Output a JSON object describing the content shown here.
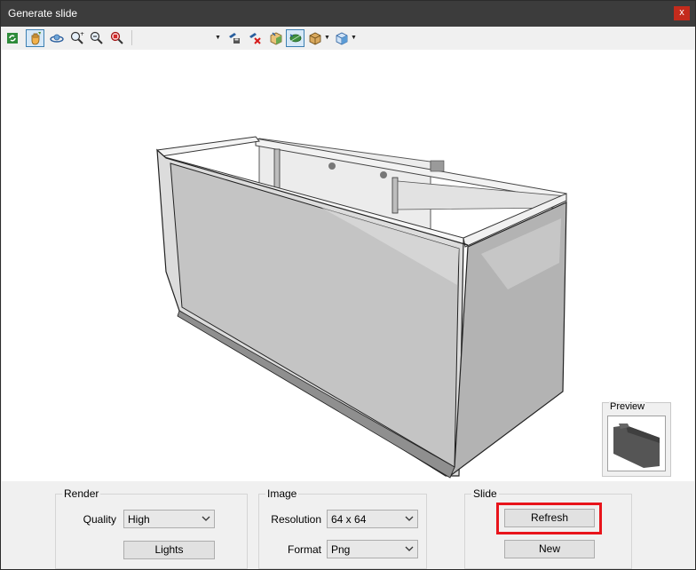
{
  "window": {
    "title": "Generate slide",
    "close_label": "x"
  },
  "toolbar": {
    "buttons": [
      {
        "name": "refresh-view-icon",
        "active": false
      },
      {
        "name": "pan-hand-icon",
        "active": true
      },
      {
        "name": "orbit-icon",
        "active": false
      },
      {
        "name": "zoom-in-icon",
        "active": false
      },
      {
        "name": "zoom-out-icon",
        "active": false
      },
      {
        "name": "zoom-extents-icon",
        "active": false
      },
      {
        "name": "save-camera-icon",
        "active": false
      },
      {
        "name": "delete-camera-icon",
        "active": false
      },
      {
        "name": "materials-icon",
        "active": false
      },
      {
        "name": "leaf-toggle-icon",
        "active": true
      },
      {
        "name": "box-view-icon",
        "active": false
      },
      {
        "name": "cube-view-icon",
        "active": false
      }
    ]
  },
  "preview": {
    "label": "Preview"
  },
  "render": {
    "legend": "Render",
    "quality_label": "Quality",
    "quality_value": "High",
    "lights_button": "Lights"
  },
  "image": {
    "legend": "Image",
    "resolution_label": "Resolution",
    "resolution_value": "64 x 64",
    "format_label": "Format",
    "format_value": "Png"
  },
  "slide": {
    "legend": "Slide",
    "refresh_button": "Refresh",
    "new_button": "New"
  },
  "colors": {
    "titlebar": "#3c3c3c",
    "close": "#c42b1c",
    "highlight": "#e8141b",
    "active_tool": "#d6e8f7"
  }
}
